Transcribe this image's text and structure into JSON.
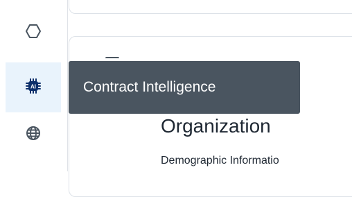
{
  "sidebar": {
    "items": [
      {
        "icon": "hexagon-icon",
        "active": false
      },
      {
        "icon": "ai-chip-icon",
        "icon_text": "AI",
        "active": true
      },
      {
        "icon": "globe-icon",
        "active": false
      }
    ]
  },
  "tooltip": {
    "text": "Contract Intelligence"
  },
  "main": {
    "section_title": "Organization",
    "section_subtitle": "Demographic Informatio"
  },
  "colors": {
    "tooltip_bg": "#4a5560",
    "active_bg": "#e9f3fc",
    "icon": "#4a5560",
    "chip": "#0d2f6b",
    "text": "#1f2833"
  }
}
